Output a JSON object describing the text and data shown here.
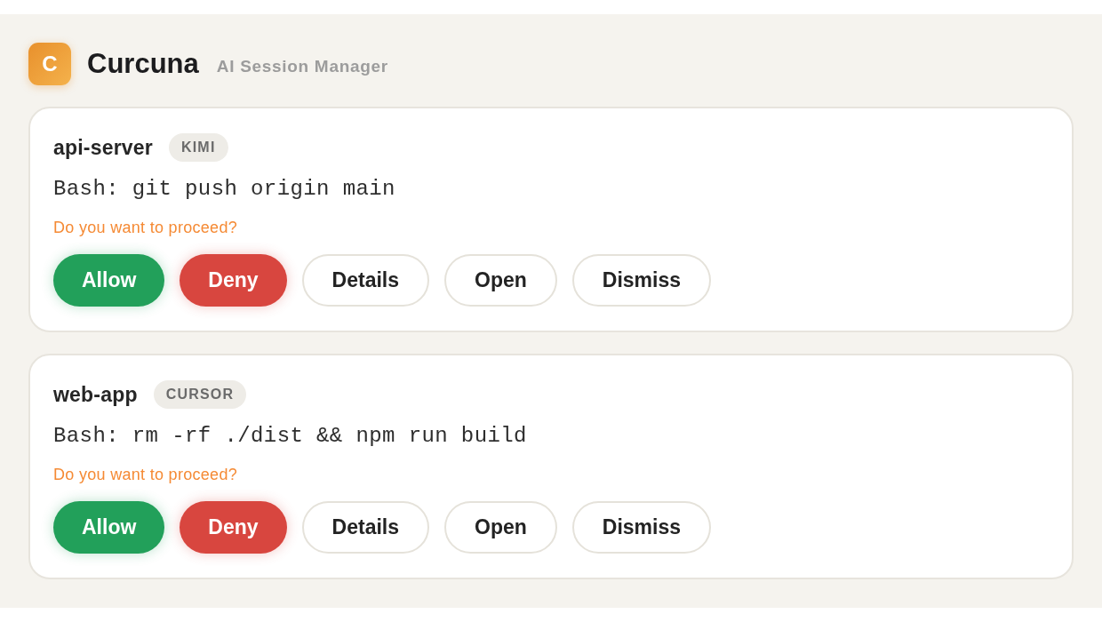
{
  "header": {
    "logo_letter": "C",
    "app_name": "Curcuna",
    "subtitle": "AI Session Manager"
  },
  "sessions": [
    {
      "name": "api-server",
      "agent": "KIMI",
      "command": "Bash: git push origin main",
      "prompt": "Do you want to proceed?",
      "actions": [
        {
          "label": "Allow",
          "kind": "allow"
        },
        {
          "label": "Deny",
          "kind": "deny"
        },
        {
          "label": "Details",
          "kind": "plain"
        },
        {
          "label": "Open",
          "kind": "plain"
        },
        {
          "label": "Dismiss",
          "kind": "plain"
        }
      ]
    },
    {
      "name": "web-app",
      "agent": "CURSOR",
      "command": "Bash: rm -rf ./dist && npm run build",
      "prompt": "Do you want to proceed?",
      "actions": [
        {
          "label": "Allow",
          "kind": "allow"
        },
        {
          "label": "Deny",
          "kind": "deny"
        },
        {
          "label": "Details",
          "kind": "plain"
        },
        {
          "label": "Open",
          "kind": "plain"
        },
        {
          "label": "Dismiss",
          "kind": "plain"
        }
      ]
    }
  ]
}
